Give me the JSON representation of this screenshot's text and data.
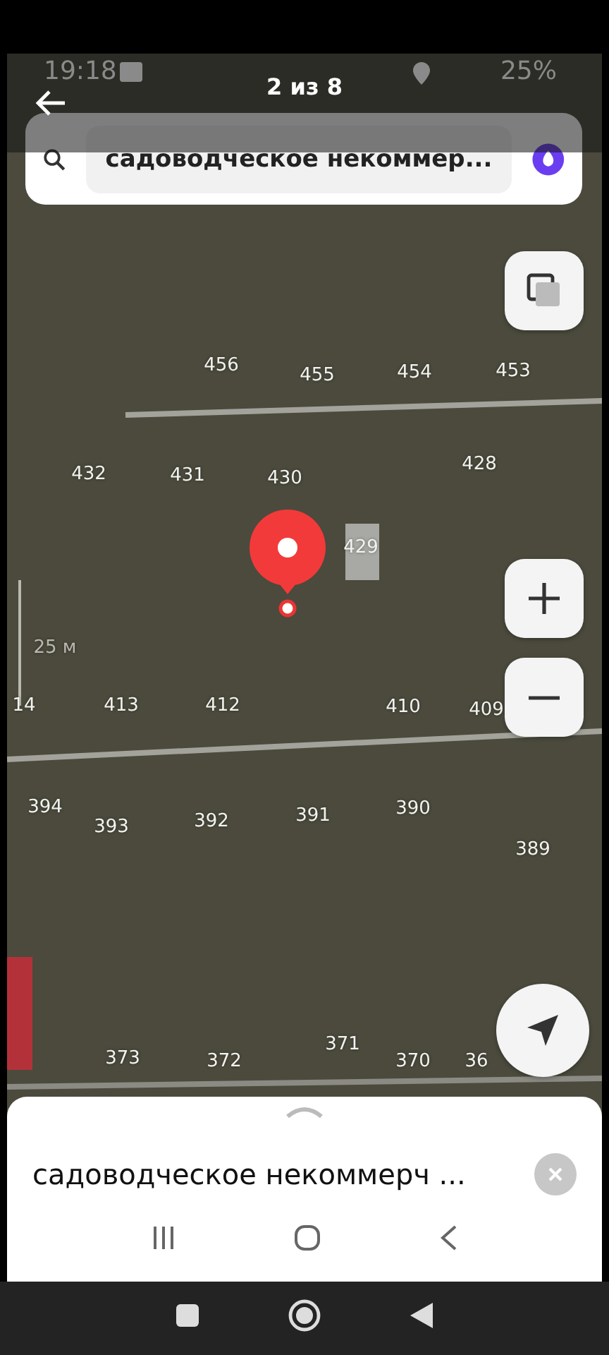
{
  "status_bar": {
    "time": "19:18",
    "battery": "25%"
  },
  "viewer": {
    "counter": "2 из 8"
  },
  "search": {
    "value": "садоводческое некоммер..."
  },
  "map": {
    "scale": "25 м",
    "labels": [
      "456",
      "455",
      "454",
      "453",
      "432",
      "431",
      "430",
      "428",
      "429",
      "14",
      "413",
      "412",
      "410",
      "409",
      "394",
      "393",
      "392",
      "391",
      "390",
      "389",
      "373",
      "372",
      "371",
      "370",
      "36"
    ]
  },
  "sheet": {
    "title": "садоводческое некоммерч ..."
  }
}
